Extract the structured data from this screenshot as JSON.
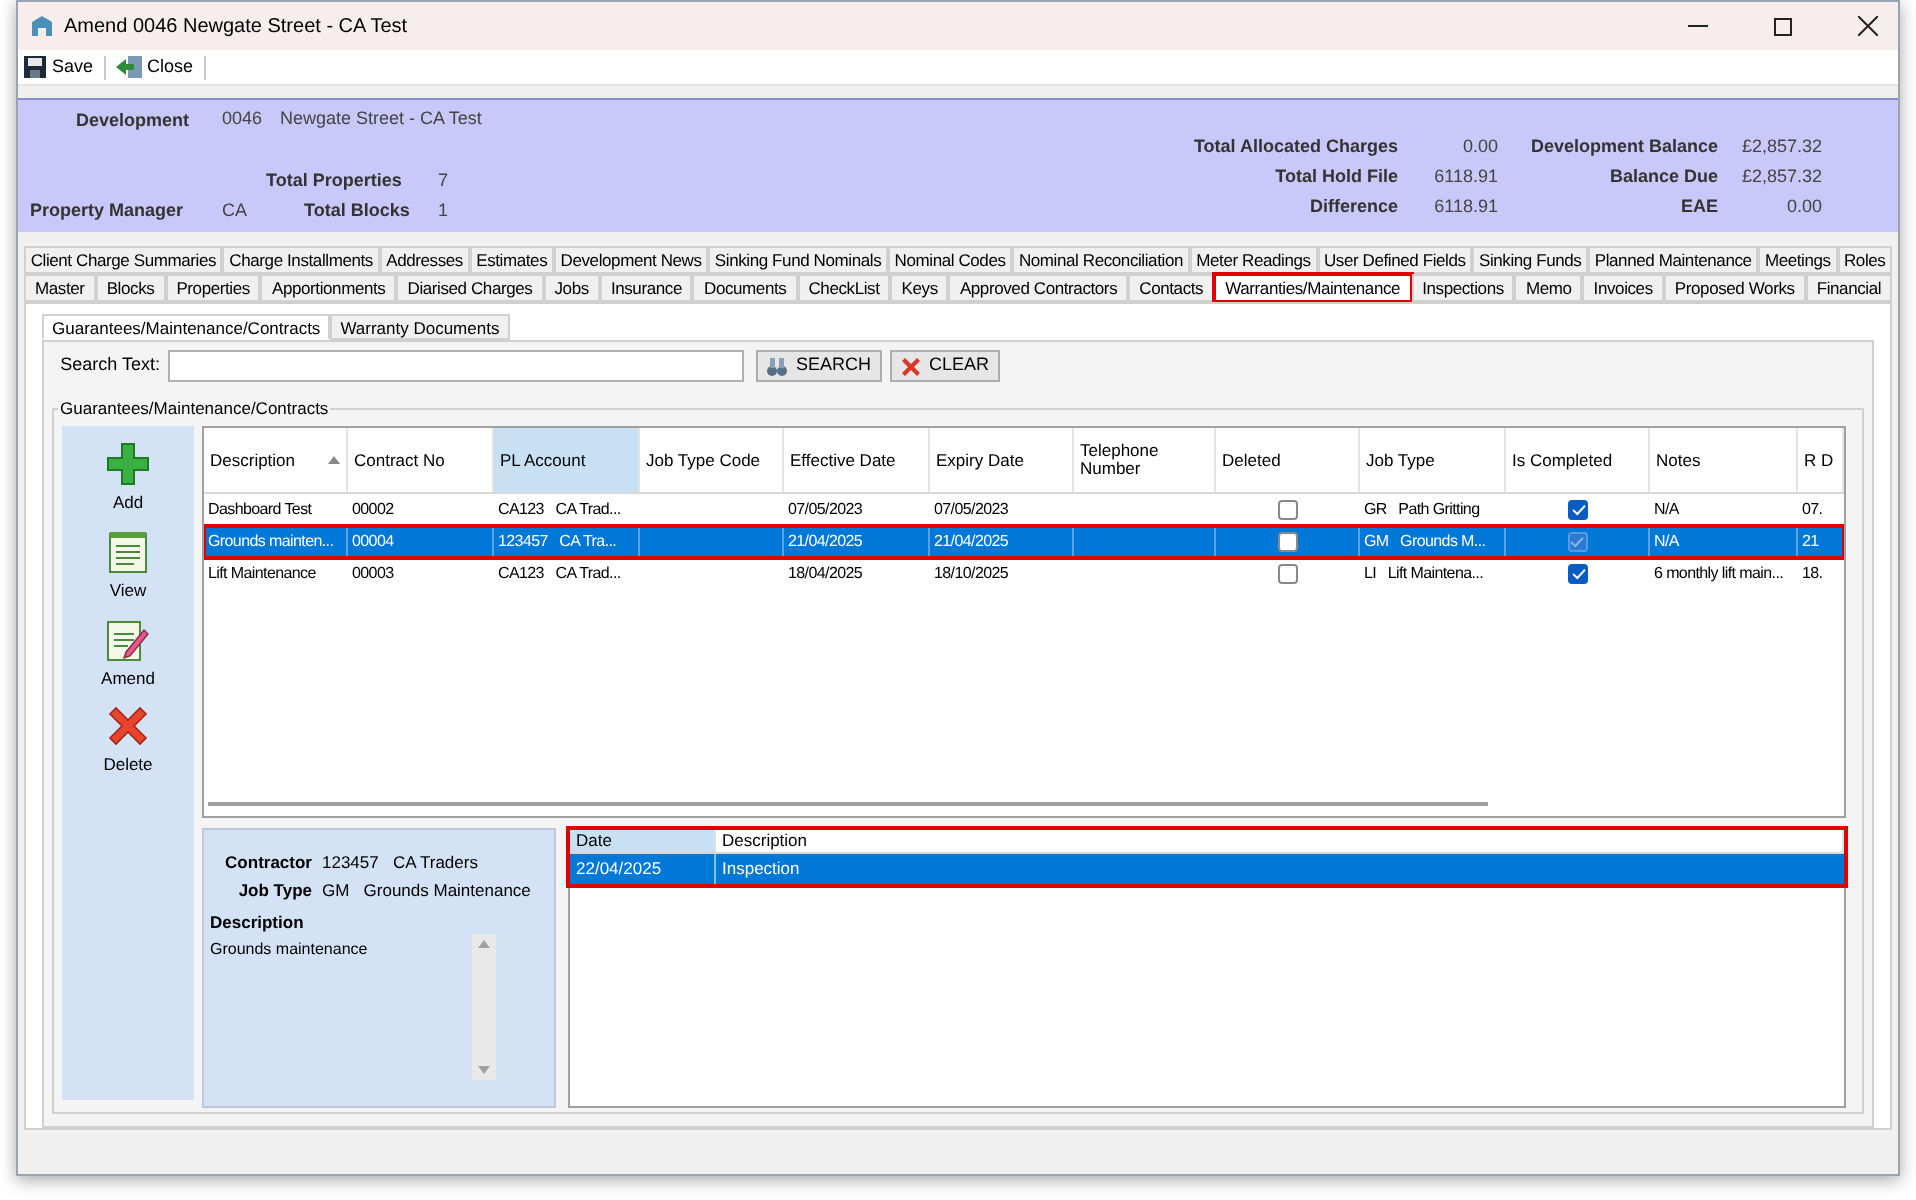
{
  "window": {
    "title": "Amend 0046 Newgate Street - CA Test"
  },
  "toolbar": [
    {
      "label": "Save",
      "kind": "save"
    },
    {
      "label": "Close",
      "kind": "close"
    }
  ],
  "info_panel": {
    "development": {
      "label": "Development",
      "code": "0046",
      "name": "Newgate Street - CA Test"
    },
    "total_properties": {
      "label": "Total Properties",
      "value": "7"
    },
    "property_manager": {
      "label": "Property Manager",
      "value": "CA"
    },
    "total_blocks": {
      "label": "Total Blocks",
      "value": "1"
    },
    "summary": [
      {
        "label": "Total Allocated Charges",
        "value": "0.00",
        "label2": "Development Balance",
        "value2": "£2,857.32"
      },
      {
        "label": "Total Hold File",
        "value": "6118.91",
        "label2": "Balance Due",
        "value2": "£2,857.32"
      },
      {
        "label": "Difference",
        "value": "6118.91",
        "label2": "EAE",
        "value2": "0.00"
      }
    ]
  },
  "tabs_row_1": [
    {
      "label": "Client Charge Summaries",
      "selected": false
    },
    {
      "label": "Charge Installments",
      "selected": false
    },
    {
      "label": "Addresses",
      "selected": false
    },
    {
      "label": "Estimates",
      "selected": false
    },
    {
      "label": "Development News",
      "selected": false
    },
    {
      "label": "Sinking Fund Nominals",
      "selected": false
    },
    {
      "label": "Nominal Codes",
      "selected": false
    },
    {
      "label": "Nominal Reconciliation",
      "selected": false
    },
    {
      "label": "Meter Readings",
      "selected": false
    },
    {
      "label": "User Defined Fields",
      "selected": false
    },
    {
      "label": "Sinking Funds",
      "selected": false
    },
    {
      "label": "Planned Maintenance",
      "selected": false
    },
    {
      "label": "Meetings",
      "selected": false
    },
    {
      "label": "Roles",
      "selected": false
    }
  ],
  "tabs_row_2": [
    {
      "label": "Master",
      "selected": false
    },
    {
      "label": "Blocks",
      "selected": false
    },
    {
      "label": "Properties",
      "selected": false
    },
    {
      "label": "Apportionments",
      "selected": false
    },
    {
      "label": "Diarised Charges",
      "selected": false
    },
    {
      "label": "Jobs",
      "selected": false
    },
    {
      "label": "Insurance",
      "selected": false
    },
    {
      "label": "Documents",
      "selected": false
    },
    {
      "label": "CheckList",
      "selected": false
    },
    {
      "label": "Keys",
      "selected": false
    },
    {
      "label": "Approved Contractors",
      "selected": false
    },
    {
      "label": "Contacts",
      "selected": false
    },
    {
      "label": "Warranties/Maintenance",
      "selected": true,
      "highlighted": true
    },
    {
      "label": "Inspections",
      "selected": false
    },
    {
      "label": "Memo",
      "selected": false
    },
    {
      "label": "Invoices",
      "selected": false
    },
    {
      "label": "Proposed Works",
      "selected": false
    },
    {
      "label": "Financial",
      "selected": false
    }
  ],
  "sub_tabs": [
    {
      "label": "Guarantees/Maintenance/Contracts",
      "selected": true
    },
    {
      "label": "Warranty Documents",
      "selected": false
    }
  ],
  "search": {
    "label": "Search Text:",
    "buttons": [
      {
        "label": "SEARCH",
        "kind": "search"
      },
      {
        "label": "CLEAR",
        "kind": "clear"
      }
    ]
  },
  "group_title": "Guarantees/Maintenance/Contracts",
  "side_buttons": [
    {
      "label": "Add",
      "kind": "add"
    },
    {
      "label": "View",
      "kind": "view"
    },
    {
      "label": "Amend",
      "kind": "amend"
    },
    {
      "label": "Delete",
      "kind": "delete"
    }
  ],
  "table": {
    "columns": [
      {
        "label": "Description",
        "sorted": true,
        "highlighted": false
      },
      {
        "label": "Contract No",
        "sorted": false,
        "highlighted": false
      },
      {
        "label": "PL Account",
        "sorted": false,
        "highlighted": true
      },
      {
        "label": "Job Type Code",
        "sorted": false,
        "highlighted": false
      },
      {
        "label": "Effective Date",
        "sorted": false,
        "highlighted": false
      },
      {
        "label": "Expiry Date",
        "sorted": false,
        "highlighted": false
      },
      {
        "label": "Telephone Number",
        "sorted": false,
        "highlighted": false
      },
      {
        "label": "Deleted",
        "sorted": false,
        "highlighted": false
      },
      {
        "label": "Job Type",
        "sorted": false,
        "highlighted": false
      },
      {
        "label": "Is Completed",
        "sorted": false,
        "highlighted": false
      },
      {
        "label": "Notes",
        "sorted": false,
        "highlighted": false
      },
      {
        "label": "R D",
        "sorted": false,
        "highlighted": false
      }
    ],
    "rows": [
      {
        "selected": false,
        "highlighted": false,
        "description": "Dashboard Test",
        "contract_no": "00002",
        "pl_account": "CA123   CA Trad...",
        "job_type_code": "",
        "effective_date": "07/05/2023",
        "expiry_date": "07/05/2023",
        "telephone": "",
        "deleted": false,
        "job_type": "GR   Path Gritting",
        "completed": true,
        "notes": "N/A",
        "column_12": "07."
      },
      {
        "selected": true,
        "highlighted": true,
        "description": "Grounds mainten...",
        "contract_no": "00004",
        "pl_account": "123457   CA Tra...",
        "job_type_code": "",
        "effective_date": "21/04/2025",
        "expiry_date": "21/04/2025",
        "telephone": "",
        "deleted": false,
        "job_type": "GM   Grounds M...",
        "completed": true,
        "notes": "N/A",
        "column_12": "21"
      },
      {
        "selected": false,
        "highlighted": false,
        "description": "Lift Maintenance",
        "contract_no": "00003",
        "pl_account": "CA123   CA Trad...",
        "job_type_code": "",
        "effective_date": "18/04/2025",
        "expiry_date": "18/10/2025",
        "telephone": "",
        "deleted": false,
        "job_type": "LI   Lift Maintena...",
        "completed": true,
        "notes": "6 monthly lift main...",
        "column_12": "18."
      }
    ]
  },
  "details": {
    "contractor": {
      "label": "Contractor",
      "value": "123457   CA Traders"
    },
    "job_type": {
      "label": "Job Type",
      "value": "GM   Grounds Maintenance"
    },
    "description": {
      "label": "Description",
      "value": "Grounds maintenance"
    }
  },
  "inspections": {
    "highlighted": true,
    "columns": [
      "Date",
      "Description"
    ],
    "rows": [
      {
        "selected": true,
        "date": "22/04/2025",
        "description": "Inspection"
      }
    ]
  }
}
